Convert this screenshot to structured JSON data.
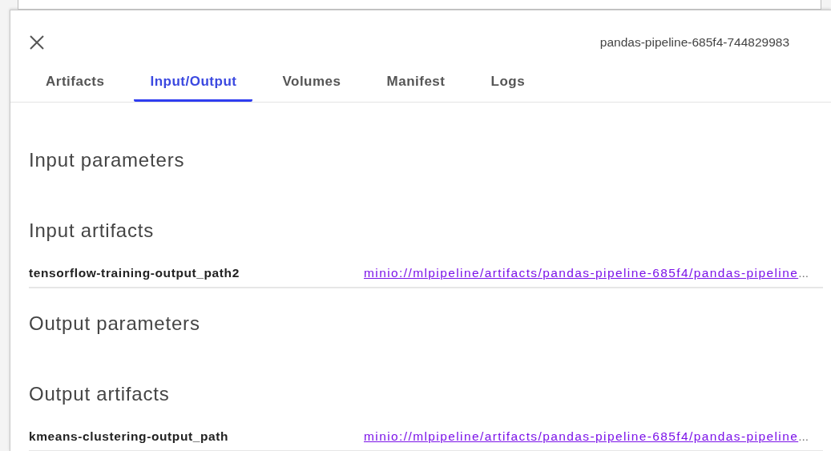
{
  "panel": {
    "run_id": "pandas-pipeline-685f4-744829983"
  },
  "tabs": [
    {
      "label": "Artifacts",
      "selected": false
    },
    {
      "label": "Input/Output",
      "selected": true
    },
    {
      "label": "Volumes",
      "selected": false
    },
    {
      "label": "Manifest",
      "selected": false
    },
    {
      "label": "Logs",
      "selected": false
    }
  ],
  "sections": [
    {
      "title": "Input parameters"
    },
    {
      "title": "Input artifacts",
      "rows": [
        {
          "name": "tensorflow-training-output_path2",
          "link": "minio://mlpipeline/artifacts/pandas-pipeline-685f4/pandas-pipeline",
          "overflow": "..."
        }
      ]
    },
    {
      "title": "Output parameters"
    },
    {
      "title": "Output artifacts",
      "rows": [
        {
          "name": "kmeans-clustering-output_path",
          "link": "minio://mlpipeline/artifacts/pandas-pipeline-685f4/pandas-pipeline",
          "overflow": "..."
        }
      ]
    }
  ]
}
